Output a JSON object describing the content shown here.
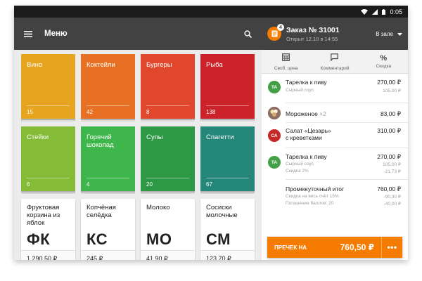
{
  "status": {
    "time": "0:05"
  },
  "header": {
    "title": "Меню"
  },
  "categories": [
    {
      "name": "Вино",
      "count": "15",
      "color": "#e6a41f"
    },
    {
      "name": "Коктейли",
      "count": "42",
      "color": "#e87022"
    },
    {
      "name": "Бургеры",
      "count": "8",
      "color": "#e0472d"
    },
    {
      "name": "Рыба",
      "count": "138",
      "color": "#cc2229"
    },
    {
      "name": "Стейки",
      "count": "6",
      "color": "#84bb37"
    },
    {
      "name": "Горячий шоколад",
      "count": "4",
      "color": "#3fb64b"
    },
    {
      "name": "Супы",
      "count": "20",
      "color": "#2e9945"
    },
    {
      "name": "Спагетти",
      "count": "67",
      "color": "#25877a"
    }
  ],
  "products": [
    {
      "name": "Фруктовая корзина из яблок",
      "abbr": "ФК",
      "price": "1 290,50 ₽"
    },
    {
      "name": "Копчёная селёдка",
      "abbr": "КС",
      "price": "245 ₽"
    },
    {
      "name": "Молоко",
      "abbr": "МО",
      "price": "41,90 ₽"
    },
    {
      "name": "Сосиски молочные",
      "abbr": "СМ",
      "price": "123,70 ₽"
    }
  ],
  "order": {
    "title": "Заказ № 31001",
    "opened": "Открыт 12.10 в 14:55",
    "location": "В зале",
    "badge": "4",
    "accent": "#f57c00"
  },
  "actions": [
    {
      "label": "Своб. цена",
      "icon": "calculator-icon"
    },
    {
      "label": "Комментарий",
      "icon": "comment-icon"
    },
    {
      "label": "Скидка",
      "icon": "percent-icon"
    }
  ],
  "items": [
    {
      "avatar": "ТА",
      "avatar_color": "#43a047",
      "name": "Тарелка к пиву",
      "price": "270,00 ₽",
      "sub1": "Сырный соус",
      "sub1v": "105,00 ₽"
    },
    {
      "name": "Мороженое",
      "qty": "×2",
      "price": "83,00 ₽",
      "avatar_icon": "ice-cream-photo"
    },
    {
      "avatar": "СА",
      "avatar_color": "#c62828",
      "name1": "Салат «Цезарь»",
      "name2": "с креветками",
      "price": "310,00 ₽"
    },
    {
      "avatar": "ТА",
      "avatar_color": "#43a047",
      "name": "Тарелка к пиву",
      "price": "270,00 ₽",
      "sub1": "Сырный соус",
      "sub1v": "105,00 ₽",
      "sub2": "Скидка 2%",
      "sub2v": "-21,73 ₽"
    }
  ],
  "subtotal": {
    "label": "Промежуточный итог",
    "value": "760,00 ₽",
    "discount_label": "Скидка на весь счёт 15%",
    "discount_value": "-90,30 ₽",
    "points_label": "Погашение баллов: 20",
    "points_value": "-40,00 ₽"
  },
  "footer": {
    "pay_label": "ПРЕЧЕК НА",
    "amount": "760,50 ₽",
    "more": "•••"
  }
}
